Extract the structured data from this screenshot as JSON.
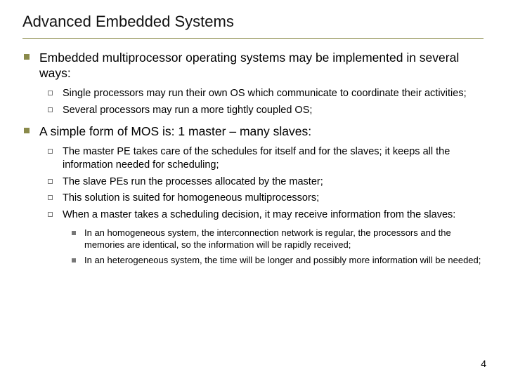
{
  "title": "Advanced Embedded Systems",
  "page_number": "4",
  "points": [
    {
      "text": "Embedded multiprocessor operating systems may be implemented in several ways:",
      "sub": [
        {
          "text": "Single processors may run their own OS which communicate to coordinate their activities;"
        },
        {
          "text": "Several processors may run a more tightly coupled OS;"
        }
      ]
    },
    {
      "text": "A simple form of MOS is: 1 master – many slaves:",
      "sub": [
        {
          "text": "The master PE takes care of the schedules for itself and for the slaves; it keeps all the information needed for scheduling;"
        },
        {
          "text": "The slave PEs run the processes allocated by the master;"
        },
        {
          "text": "This solution is suited for homogeneous multiprocessors;"
        },
        {
          "text": "When a master takes a scheduling decision, it may receive information from the slaves:",
          "sub": [
            {
              "text": "In an homogeneous system, the interconnection network is regular, the processors and the memories are identical, so the information will be rapidly received;"
            },
            {
              "text": "In an heterogeneous system, the time will be longer and possibly more information will be needed;"
            }
          ]
        }
      ]
    }
  ]
}
